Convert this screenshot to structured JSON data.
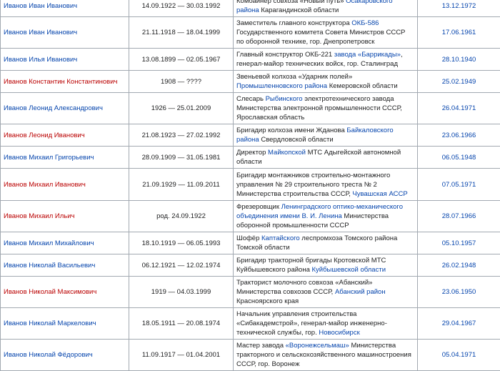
{
  "rows": [
    {
      "name": "Иванов Иван Иванович",
      "red": false,
      "dates": "14.09.1922 — 30.03.1992",
      "desc": {
        "pre": "Комбайнер совхоза «Новый путь» ",
        "link": "Осакаровского района",
        "post": " Карагандинской области"
      },
      "award": "13.12.1972",
      "h": 26
    },
    {
      "name": "Иванов Иван Иванович",
      "red": false,
      "dates": "21.11.1918 — 18.04.1999",
      "desc": {
        "pre": "Заместитель главного конструктора ",
        "link": "ОКБ-586",
        "post": " Государственного комитета Совета Министров СССР по оборонной технике, гор. Днепропетровск"
      },
      "award": "17.06.1961",
      "h": 44
    },
    {
      "name": "Иванов Илья Иванович",
      "red": false,
      "dates": "13.08.1899 — 02.05.1967",
      "desc": {
        "pre": "Главный конструктор ОКБ-221 ",
        "link": "завода «Баррикады»",
        "post": ", генерал-майор технических войск, гор. Сталинград"
      },
      "award": "28.10.1940",
      "h": 29
    },
    {
      "name": "Иванов Константин Константинович",
      "red": true,
      "dates": "1908 — ????",
      "desc": {
        "pre": "Звеньевой колхоза «Ударник полей» ",
        "link": "Промышленновского района",
        "post": " Кемеровской области"
      },
      "award": "25.02.1949",
      "h": 30
    },
    {
      "name": "Иванов Леонид Александрович",
      "red": false,
      "dates": "1926 — 25.01.2009",
      "desc": {
        "pre": "Слесарь ",
        "link": "Рыбинского",
        "post": " электротехнического завода Министерства электронной промышленности СССР, Ярославская область"
      },
      "award": "26.04.1971",
      "h": 32
    },
    {
      "name": "Иванов Леонид Иванович",
      "red": true,
      "dates": "21.08.1923 — 27.02.1992",
      "desc": {
        "pre": "Бригадир колхоза имени Жданова ",
        "link": "Байкаловского района",
        "post": " Свердловской области"
      },
      "award": "23.06.1966",
      "h": 30
    },
    {
      "name": "Иванов Михаил Григорьевич",
      "red": false,
      "dates": "28.09.1909 — 31.05.1981",
      "desc": {
        "pre": "Директор ",
        "link": "Майкопской",
        "post": " МТС Адыгейской автономной области"
      },
      "award": "06.05.1948",
      "h": 17
    },
    {
      "name": "Иванов Михаил Иванович",
      "red": true,
      "dates": "21.09.1929 — 11.09.2011",
      "desc": {
        "pre": "Бригадир монтажников строительно-монтажного управления № 29 строительного треста № 2 Министерства строительства СССР, ",
        "link": "Чувашская АССР",
        "post": ""
      },
      "award": "07.05.1971",
      "h": 45
    },
    {
      "name": "Иванов Михаил Ильич",
      "red": true,
      "dates": "род. 24.09.1922",
      "desc": {
        "pre": "Фрезеровщик ",
        "link": "Ленинградского оптико-механического объединения имени В. И. Ленина",
        "post": " Министерства оборонной промышленности СССР"
      },
      "award": "28.07.1966",
      "h": 44
    },
    {
      "name": "Иванов Михаил Михайлович",
      "red": false,
      "dates": "18.10.1919 — 06.05.1993",
      "desc": {
        "pre": "Шофёр ",
        "link": "Каптайского",
        "post": " леспромхоза Томского района Томской области"
      },
      "award": "05.10.1957",
      "h": 17
    },
    {
      "name": "Иванов Николай Васильевич",
      "red": false,
      "dates": "06.12.1921 — 12.02.1974",
      "desc": {
        "pre": "Бригадир тракторной бригады Кротовской МТС Куйбышевского района ",
        "link": "Куйбышевской области",
        "post": ""
      },
      "award": "26.02.1948",
      "h": 31
    },
    {
      "name": "Иванов Николай Максимович",
      "red": true,
      "dates": "1919 — 04.03.1999",
      "desc": {
        "pre": "Тракторист молочного совхоза «Абанский» Министерства совхозов СССР, ",
        "link": "Абанский район",
        "post": " Красноярского края"
      },
      "award": "23.06.1950",
      "h": 30
    },
    {
      "name": "Иванов Николай Маркелович",
      "red": false,
      "dates": "18.05.1911 — 20.08.1974",
      "desc": {
        "pre": "Начальник управления строительства «Сибакадемстрой», генерал-майор инженерно-технической службы, гор. ",
        "link": "Новосибирск",
        "post": ""
      },
      "award": "29.04.1967",
      "h": 30
    },
    {
      "name": "Иванов Николай Фёдорович",
      "red": false,
      "dates": "11.09.1917 — 01.04.2001",
      "desc": {
        "pre": "Мастер завода ",
        "link": "«Воронежсельмаш»",
        "post": " Министерства тракторного и сельскохозяйственного машиностроения СССР, гор. Воронеж"
      },
      "award": "05.04.1971",
      "h": 32
    }
  ]
}
